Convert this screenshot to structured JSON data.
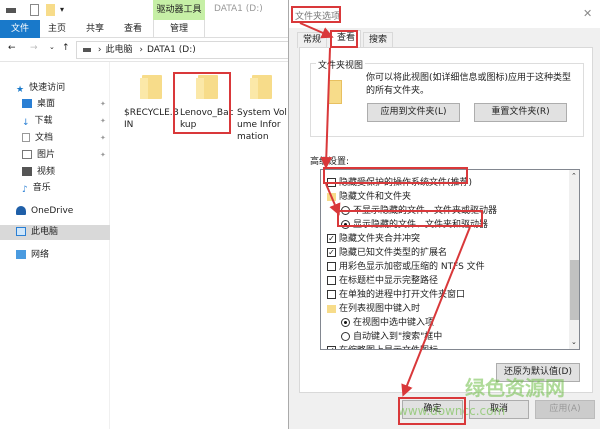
{
  "explorer": {
    "window_title": "DATA1 (D:)",
    "context_tab_group": "驱动器工具",
    "ribbon_tabs": [
      "文件",
      "主页",
      "共享",
      "查看",
      "管理"
    ],
    "breadcrumb": [
      "此电脑",
      "DATA1 (D:)"
    ],
    "nav": [
      "快速访问",
      "桌面",
      "下载",
      "文档",
      "图片",
      "视频",
      "音乐",
      "OneDrive",
      "此电脑",
      "网络"
    ],
    "folders": [
      "$RECYCLE.BIN",
      "Lenovo_Backup",
      "System Volume Information"
    ]
  },
  "dialog": {
    "title": "文件夹选项",
    "tabs": [
      "常规",
      "查看",
      "搜索"
    ],
    "folder_views_group": "文件夹视图",
    "folder_views_desc": "你可以将此视图(如详细信息或图标)应用于这种类型的所有文件夹。",
    "apply_to_folders": "应用到文件夹(L)",
    "reset_folders": "重置文件夹(R)",
    "advanced_label": "高级设置:",
    "settings": [
      {
        "type": "checkbox",
        "checked": false,
        "label": "隐藏受保护的操作系统文件(推荐)"
      },
      {
        "type": "folder",
        "label": "隐藏文件和文件夹"
      },
      {
        "type": "radio",
        "checked": false,
        "label": "不显示隐藏的文件、文件夹或驱动器"
      },
      {
        "type": "radio",
        "checked": true,
        "label": "显示隐藏的文件、文件夹和驱动器"
      },
      {
        "type": "checkbox",
        "checked": true,
        "label": "隐藏文件夹合并冲突"
      },
      {
        "type": "checkbox",
        "checked": true,
        "label": "隐藏已知文件类型的扩展名"
      },
      {
        "type": "checkbox",
        "checked": false,
        "label": "用彩色显示加密或压缩的 NTFS 文件"
      },
      {
        "type": "checkbox",
        "checked": false,
        "label": "在标题栏中显示完整路径"
      },
      {
        "type": "checkbox",
        "checked": false,
        "label": "在单独的进程中打开文件夹窗口"
      },
      {
        "type": "folder",
        "label": "在列表视图中键入时"
      },
      {
        "type": "radio",
        "checked": true,
        "label": "在视图中选中键入项"
      },
      {
        "type": "radio",
        "checked": false,
        "label": "自动键入到\"搜索\"框中"
      },
      {
        "type": "checkbox",
        "checked": true,
        "label": "在缩略图上显示文件图标"
      }
    ],
    "restore_defaults": "还原为默认值(D)",
    "ok": "确定",
    "cancel": "取消",
    "apply": "应用(A)"
  },
  "watermark": {
    "title": "绿色资源网",
    "url": "www.downcc.com"
  },
  "colors": {
    "accent": "#1979ca",
    "annotation": "#d9383a",
    "context": "#c6efa6"
  }
}
